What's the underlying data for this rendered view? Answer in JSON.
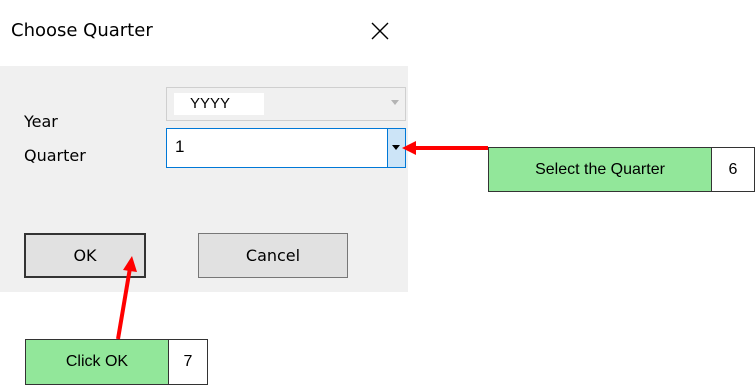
{
  "dialog": {
    "title": "Choose Quarter",
    "year_label": "Year",
    "year_value": "YYYY",
    "quarter_label": "Quarter",
    "quarter_value": "1",
    "ok_label": "OK",
    "cancel_label": "Cancel"
  },
  "annotations": {
    "select_quarter": {
      "text": "Select the Quarter",
      "step": "6"
    },
    "click_ok": {
      "text": "Click OK",
      "step": "7"
    }
  },
  "colors": {
    "callout_fill": "#92e79a",
    "arrow": "#ff0000",
    "focus_border": "#0078d7"
  }
}
